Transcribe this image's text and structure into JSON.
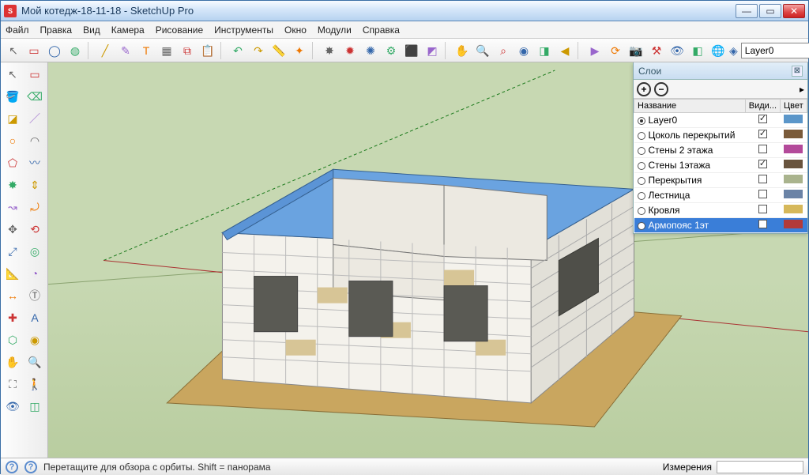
{
  "window": {
    "title": "Мой котедж-18-11-18 - SketchUp Pro"
  },
  "menu": [
    "Файл",
    "Правка",
    "Вид",
    "Камера",
    "Рисование",
    "Инструменты",
    "Окно",
    "Модули",
    "Справка"
  ],
  "layer_selector": {
    "selected": "Layer0",
    "options": [
      "Layer0"
    ]
  },
  "layers_panel": {
    "title": "Слои",
    "columns": {
      "name": "Название",
      "visible": "Види...",
      "color": "Цвет"
    },
    "rows": [
      {
        "name": "Layer0",
        "active": true,
        "visible": true,
        "color": "#5b96c9"
      },
      {
        "name": "Цоколь перекрытий",
        "active": false,
        "visible": true,
        "color": "#7a5b3a"
      },
      {
        "name": "Стены 2 этажа",
        "active": false,
        "visible": false,
        "color": "#b34a9a"
      },
      {
        "name": "Стены 1этажа",
        "active": false,
        "visible": true,
        "color": "#69543e"
      },
      {
        "name": "Перекрытия",
        "active": false,
        "visible": false,
        "color": "#a9b38d"
      },
      {
        "name": "Лестница",
        "active": false,
        "visible": false,
        "color": "#6b83a6"
      },
      {
        "name": "Кровля",
        "active": false,
        "visible": false,
        "color": "#d6b85a"
      },
      {
        "name": "Армопояс 1эт",
        "active": false,
        "visible": true,
        "color": "#b23a3a",
        "selected": true
      }
    ]
  },
  "statusbar": {
    "hint": "Перетащите для обзора с орбиты. Shift = панорама",
    "measure_label": "Измерения"
  },
  "top_toolbar_icons": [
    "cursor-icon",
    "box-icon",
    "sphere-icon",
    "cylinder-icon",
    "line-icon",
    "pencil-icon",
    "text-icon",
    "highlight-icon",
    "copy-icon",
    "paste-icon",
    "undo-icon",
    "redo-icon",
    "ruler-icon",
    "component-star-icon",
    "star-icon",
    "star2-icon",
    "explode-icon",
    "gear-icon",
    "box3d-icon",
    "box3d-copy-icon",
    "hand-pan-icon",
    "zoom-icon",
    "zoom-window-icon",
    "orbit-icon",
    "plane-icon",
    "prev-view-icon",
    "next-view-icon",
    "orbit2-icon",
    "cam-icon",
    "settings-icon",
    "hide-icon",
    "xray-icon",
    "earth-icon"
  ],
  "left_toolbar_icons": [
    "select-icon",
    "rect-icon",
    "paint-icon",
    "eraser-icon",
    "rect-face-icon",
    "line2-icon",
    "circle-icon",
    "arc-icon",
    "polygon-icon",
    "freehand-icon",
    "star-move-icon",
    "pushpull-icon",
    "follow-icon",
    "rotate-arc-icon",
    "move-icon",
    "rotate-icon",
    "scale-icon",
    "offset-icon",
    "tape-icon",
    "protractor-icon",
    "dimension-icon",
    "text-label-icon",
    "axes-icon",
    "text-a-icon",
    "sandbox-icon",
    "orbit-left-icon",
    "pan-hand-icon",
    "zoom-left-icon",
    "zoom-ext-icon",
    "walk-icon",
    "look-icon",
    "section-icon"
  ]
}
